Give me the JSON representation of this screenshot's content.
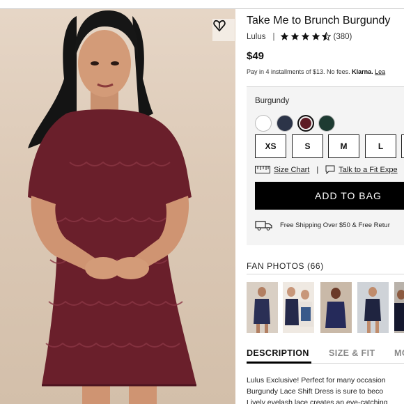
{
  "product": {
    "title": "Take Me to Brunch Burgundy",
    "brand": "Lulus",
    "separator": "|",
    "review_count": "(380)",
    "rating": 4.5,
    "price": "$49",
    "installments": "Pay in 4 installments of $13. No fees.",
    "klarna": "Klarna.",
    "learn_more": "Lea"
  },
  "variant": {
    "color_label": "Burgundy",
    "swatches": [
      {
        "name": "white",
        "color": "#ffffff"
      },
      {
        "name": "navy",
        "color": "#2c3448"
      },
      {
        "name": "burgundy",
        "color": "#5e1c25"
      },
      {
        "name": "dark-green",
        "color": "#1e3b32"
      }
    ],
    "sizes": [
      "XS",
      "S",
      "M",
      "L"
    ],
    "size_chart": "Size Chart",
    "fit_divider": "|",
    "fit_expert": "Talk to a Fit Expe",
    "add_to_bag": "ADD TO BAG",
    "shipping": "Free Shipping Over $50 & Free Retur"
  },
  "fan_photos": {
    "heading": "FAN PHOTOS (66)"
  },
  "tabs": {
    "description": "DESCRIPTION",
    "size_fit": "SIZE & FIT",
    "more": "MC"
  },
  "description": {
    "line1": "Lulus Exclusive! Perfect for many occasion",
    "line2": "Burgundy Lace Shift Dress is sure to beco",
    "line3": "Lively eyelash lace creates an eye-catching"
  },
  "colors": {
    "accent": "#000000",
    "dress": "#6a1f2b"
  }
}
